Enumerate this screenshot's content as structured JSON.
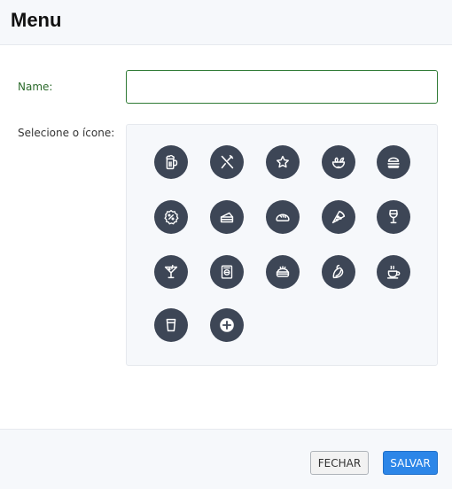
{
  "header": {
    "title": "Menu"
  },
  "form": {
    "name_label": "Name:",
    "name_value": "",
    "icon_label": "Selecione o ícone:"
  },
  "icons": [
    "beer-mug-icon",
    "utensils-icon",
    "star-icon",
    "salad-bowl-icon",
    "hamburger-icon",
    "discount-badge-icon",
    "cake-slice-icon",
    "bread-icon",
    "pizza-slice-icon",
    "wine-glass-icon",
    "cocktail-icon",
    "cookbook-icon",
    "sandwich-icon",
    "taco-icon",
    "coffee-cup-icon",
    "drinking-cup-icon",
    "add-icon"
  ],
  "colors": {
    "icon_background": "#3d4656",
    "primary_button": "#2c86e8",
    "name_label": "#2b6a2b"
  },
  "footer": {
    "close_label": "FECHAR",
    "save_label": "SALVAR"
  }
}
